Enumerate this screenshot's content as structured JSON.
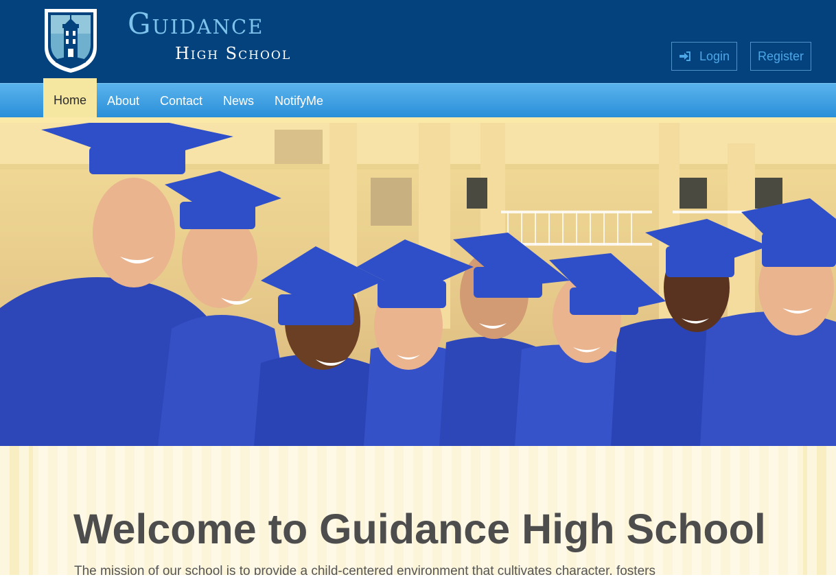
{
  "brand": {
    "title": "Guidance",
    "subtitle": "High School"
  },
  "header_buttons": {
    "login": "Login",
    "register": "Register"
  },
  "nav": {
    "items": [
      {
        "label": "Home",
        "active": true
      },
      {
        "label": "About",
        "active": false
      },
      {
        "label": "Contact",
        "active": false
      },
      {
        "label": "News",
        "active": false
      },
      {
        "label": "NotifyMe",
        "active": false
      }
    ]
  },
  "hero": {
    "alt": "Graduates in blue caps and gowns"
  },
  "welcome": {
    "title": "Welcome to Guidance High School",
    "text": "The mission of our school is to provide a child-centered environment that cultivates character, fosters"
  },
  "colors": {
    "header_bg": "#04427e",
    "nav_blue": "#2a8fd9",
    "nav_active": "#f6e7a0",
    "brand_light_blue": "#7ec3ec"
  }
}
